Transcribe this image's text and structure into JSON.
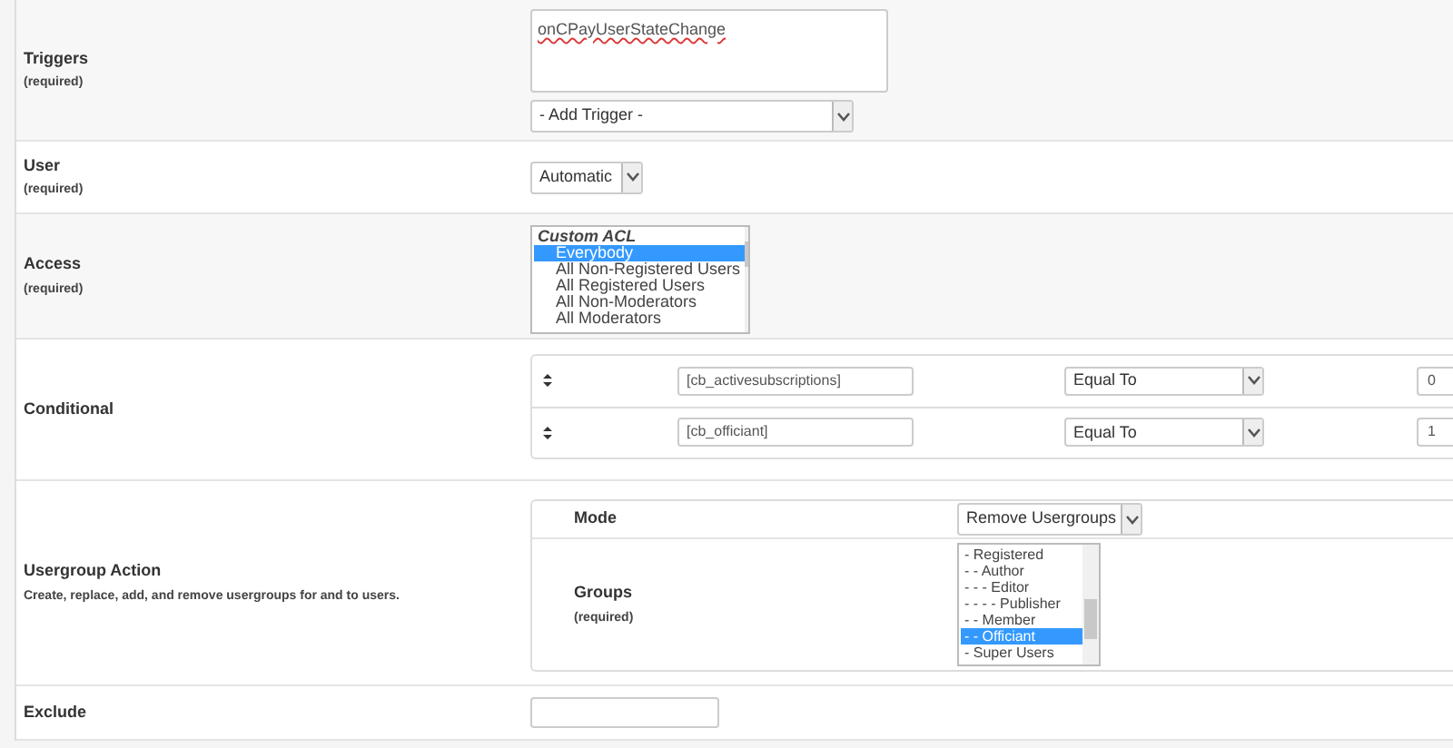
{
  "rows": [
    {
      "kind": "triggers",
      "label": "Triggers",
      "required": "(required)",
      "value": "onCPayUserStateChange",
      "select": "- Add Trigger -"
    },
    {
      "kind": "user",
      "label": "User",
      "required": "(required)",
      "select": "Automatic"
    },
    {
      "kind": "access",
      "label": "Access",
      "required": "(required)",
      "options": [
        {
          "text": "Custom ACL",
          "group": true,
          "selected": false
        },
        {
          "text": "Everybody",
          "group": false,
          "selected": true
        },
        {
          "text": "All Non-Registered Users",
          "group": false,
          "selected": false
        },
        {
          "text": "All Registered Users",
          "group": false,
          "selected": false
        },
        {
          "text": "All Non-Moderators",
          "group": false,
          "selected": false
        },
        {
          "text": "All Moderators",
          "group": false,
          "selected": false
        }
      ]
    },
    {
      "kind": "conditional",
      "label": "Conditional",
      "conditions": [
        {
          "field": "[cb_activesubscriptions]",
          "operator": "Equal To",
          "value": "0"
        },
        {
          "field": "[cb_officiant]",
          "operator": "Equal To",
          "value": "1"
        }
      ]
    },
    {
      "kind": "usergroup",
      "label": "Usergroup Action",
      "description": "Create, replace, add, and remove usergroups for and to users.",
      "mode_label": "Mode",
      "mode": "Remove Usergroups",
      "groups_label": "Groups",
      "groups_required": "(required)",
      "groups": [
        {
          "text": "- Registered",
          "selected": false
        },
        {
          "text": "- - Author",
          "selected": false
        },
        {
          "text": "- - - Editor",
          "selected": false
        },
        {
          "text": "- - - - Publisher",
          "selected": false
        },
        {
          "text": "- - Member",
          "selected": false
        },
        {
          "text": "- - Officiant",
          "selected": true
        },
        {
          "text": "- Super Users",
          "selected": false
        }
      ]
    },
    {
      "kind": "exclude",
      "label": "Exclude"
    }
  ]
}
